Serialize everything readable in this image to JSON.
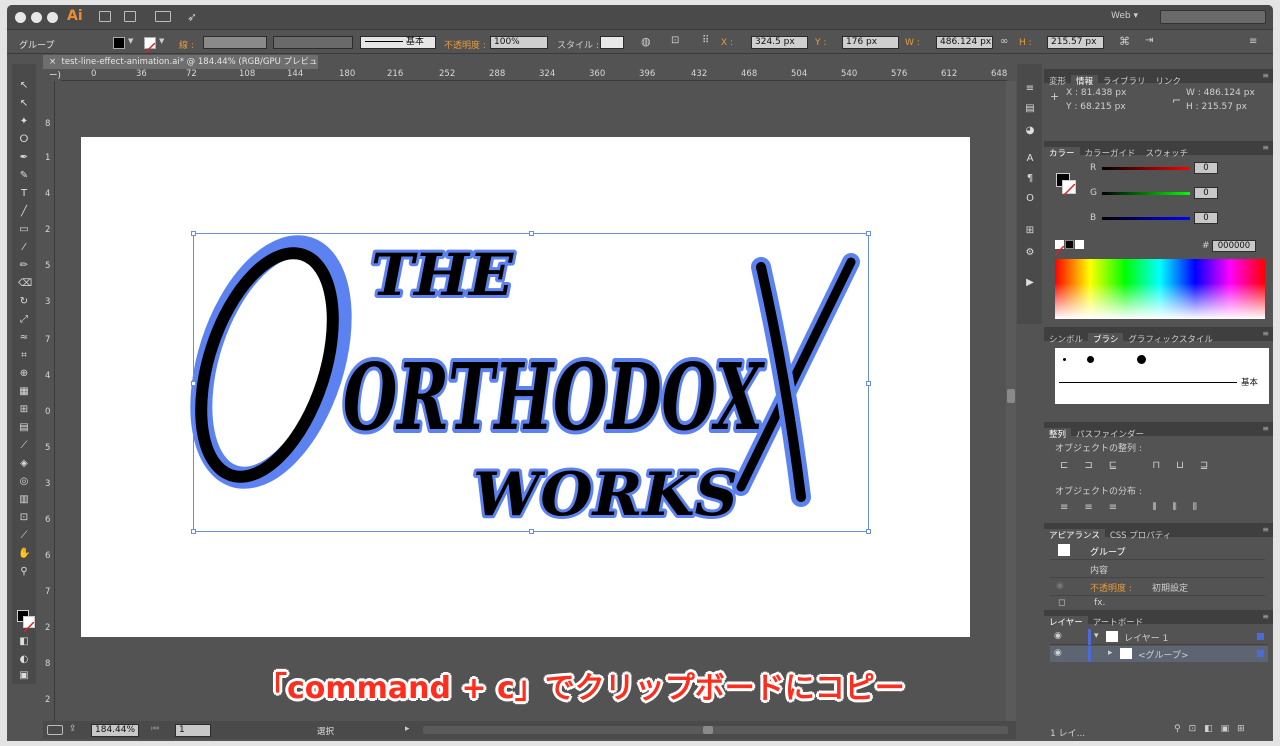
{
  "app": {
    "logo": "Ai",
    "workspace": "Web",
    "workspace_caret": "▾"
  },
  "control_bar": {
    "selection_type": "グループ",
    "stroke_label": "線 :",
    "stroke_style": "基本",
    "opacity_label": "不透明度 :",
    "opacity_value": "100%",
    "style_label": "スタイル :",
    "x_label": "X :",
    "x_value": "324.5 px",
    "y_label": "Y :",
    "y_value": "176 px",
    "w_label": "W :",
    "w_value": "486.124 px",
    "h_label": "H :",
    "h_value": "215.57 px"
  },
  "document": {
    "tab_title": "test-line-effect-animation.ai* @ 184.44% (RGB/GPU プレビュー)",
    "ruler_h": [
      "0",
      "36",
      "72",
      "108",
      "144",
      "180",
      "216",
      "252",
      "288",
      "324",
      "360",
      "396",
      "432",
      "468",
      "504",
      "540",
      "576",
      "612",
      "648"
    ],
    "ruler_v": [
      "8",
      "1",
      "4",
      "2",
      "5",
      "3",
      "7",
      "4",
      "0",
      "5",
      "3",
      "6",
      "6",
      "7",
      "2",
      "8",
      "2"
    ]
  },
  "artwork": {
    "lines": [
      "THE",
      "ORTHODOX",
      "WORKS"
    ]
  },
  "status_bar": {
    "zoom": "184.44%",
    "artboard_num": "1",
    "tool_name": "選択"
  },
  "caption": "「command + c」でクリップボードにコピー",
  "panels": {
    "info_tabs": [
      "変形",
      "情報",
      "ライブラリ",
      "リンク"
    ],
    "info": {
      "x": "X : 81.438 px",
      "y": "Y : 68.215 px",
      "w": "W : 486.124 px",
      "h": "H : 215.57 px"
    },
    "color_tabs": [
      "カラー",
      "カラーガイド",
      "スウォッチ"
    ],
    "color": {
      "r_label": "R",
      "g_label": "G",
      "b_label": "B",
      "r": "0",
      "g": "0",
      "b": "0",
      "hex_label": "#",
      "hex": "000000"
    },
    "brush_tabs": [
      "シンボル",
      "ブラシ",
      "グラフィックスタイル"
    ],
    "brush_basic": "基本",
    "align_tabs": [
      "整列",
      "パスファインダー"
    ],
    "align_objects": "オブジェクトの整列 :",
    "distribute_objects": "オブジェクトの分布 :",
    "appearance_tabs": [
      "アピアランス",
      "CSS プロパティ"
    ],
    "appearance": {
      "group": "グループ",
      "contents": "内容",
      "opacity_label": "不透明度 :",
      "opacity_value": "初期設定",
      "fx": "fx."
    },
    "layers_tabs": [
      "レイヤー",
      "アートボード"
    ],
    "layers": {
      "layer1": "レイヤー 1",
      "group": "<グループ>",
      "footer": "1 レイ..."
    }
  },
  "colors": {
    "accent": "#e89a3a",
    "selection": "#6b8ed8",
    "caption": "#ff2d1d",
    "art_blue": "#5b82f0"
  }
}
